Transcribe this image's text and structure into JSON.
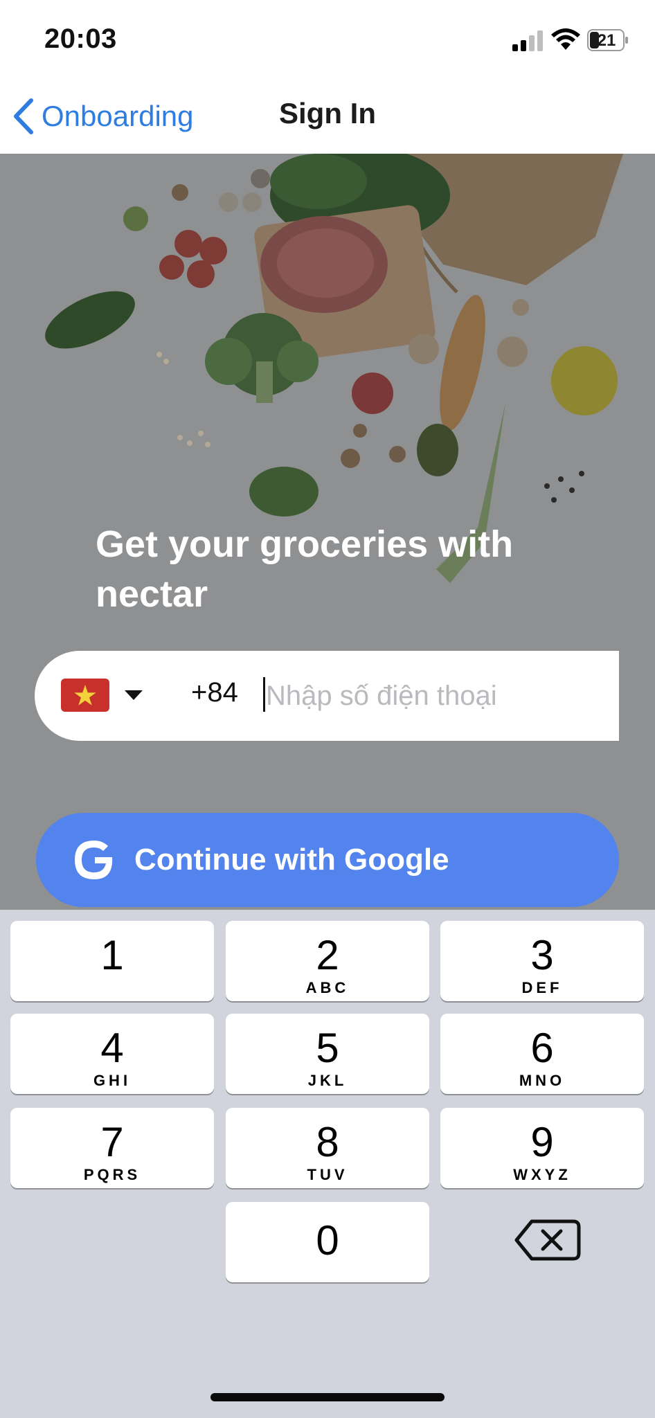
{
  "status_bar": {
    "time": "20:03",
    "battery": "21"
  },
  "nav": {
    "back_label": "Onboarding",
    "title": "Sign In"
  },
  "hero": {
    "headline": "Get your groceries with nectar"
  },
  "phone": {
    "country_code": "+84",
    "placeholder": "Nhập số điện thoại",
    "value": "",
    "flag": "vietnam-flag"
  },
  "google_button": {
    "label": "Continue with Google"
  },
  "keypad": {
    "keys": [
      {
        "number": "1",
        "letters": ""
      },
      {
        "number": "2",
        "letters": "ABC"
      },
      {
        "number": "3",
        "letters": "DEF"
      },
      {
        "number": "4",
        "letters": "GHI"
      },
      {
        "number": "5",
        "letters": "JKL"
      },
      {
        "number": "6",
        "letters": "MNO"
      },
      {
        "number": "7",
        "letters": "PQRS"
      },
      {
        "number": "8",
        "letters": "TUV"
      },
      {
        "number": "9",
        "letters": "WXYZ"
      },
      {
        "number": "0",
        "letters": ""
      }
    ]
  },
  "colors": {
    "accent": "#2f7de1",
    "google_button": "#5383ec",
    "keyboard_bg": "#d1d4dc",
    "overlay": "#8e8f91"
  }
}
